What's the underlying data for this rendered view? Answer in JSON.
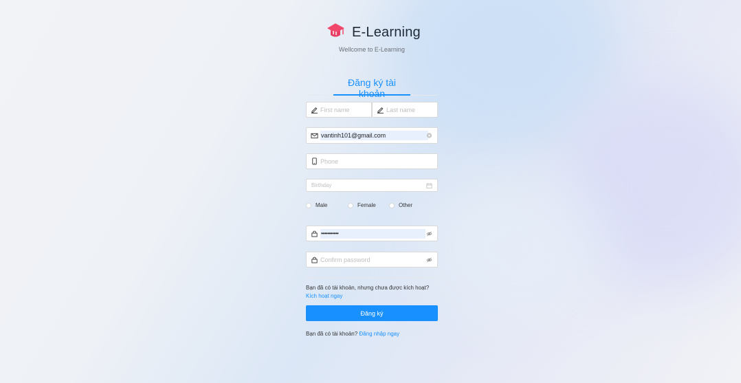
{
  "brand": {
    "title": "E-Learning",
    "subtitle": "Wellcome to E-Learning",
    "logo_icon": "graduation-cap-icon",
    "logo_color": "#f0476b"
  },
  "tab": {
    "label": "Đăng ký tài khoản"
  },
  "form": {
    "first_name": {
      "placeholder": "First name",
      "value": ""
    },
    "last_name": {
      "placeholder": "Last name",
      "value": ""
    },
    "email": {
      "placeholder": "",
      "value": "vantinh101@gmail.com"
    },
    "phone": {
      "placeholder": "Phone",
      "value": ""
    },
    "birthday": {
      "placeholder": "Birthday",
      "value": ""
    },
    "gender": {
      "options": [
        "Male",
        "Female",
        "Other"
      ],
      "selected": ""
    },
    "password": {
      "value": "•••••••••••"
    },
    "confirm_password": {
      "placeholder": "Confirm password",
      "value": ""
    }
  },
  "activation": {
    "question": "Bạn đã có tài khoản, nhưng chưa được kích hoạt?",
    "link": "Kích hoạt ngay"
  },
  "submit": {
    "label": "Đăng ký"
  },
  "login": {
    "question": "Bạn đã có tài khoản?",
    "link": "Đăng nhập ngay"
  },
  "colors": {
    "accent": "#1890ff",
    "autofill": "#e8f0fe"
  }
}
